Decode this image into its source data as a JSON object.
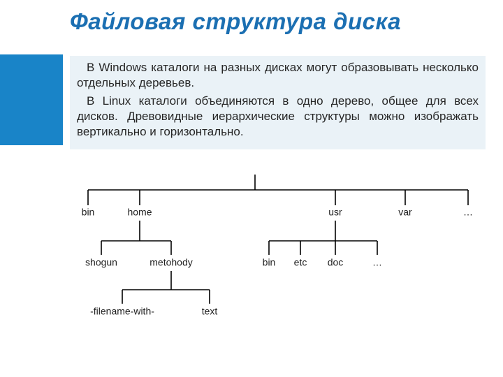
{
  "title": "Файловая структура диска",
  "paragraphs": {
    "p1": "В Windows каталоги на разных дисках могут образовывать несколько отдельных деревьев.",
    "p2": "В Linux каталоги объединяются в одно дерево, общее для всех дисков. Древовидные иерархические структуры можно изображать вертикально и горизонтально."
  },
  "tree": {
    "level1": {
      "bin": "bin",
      "home": "home",
      "usr": "usr",
      "var": "var",
      "dots": "…"
    },
    "home_children": {
      "shogun": "shogun",
      "metohody": "metohody"
    },
    "metohody_children": {
      "file1": "-filename-with-",
      "file2": "text"
    },
    "usr_children": {
      "bin": "bin",
      "etc": "etc",
      "doc": "doc",
      "dots": "…"
    }
  }
}
